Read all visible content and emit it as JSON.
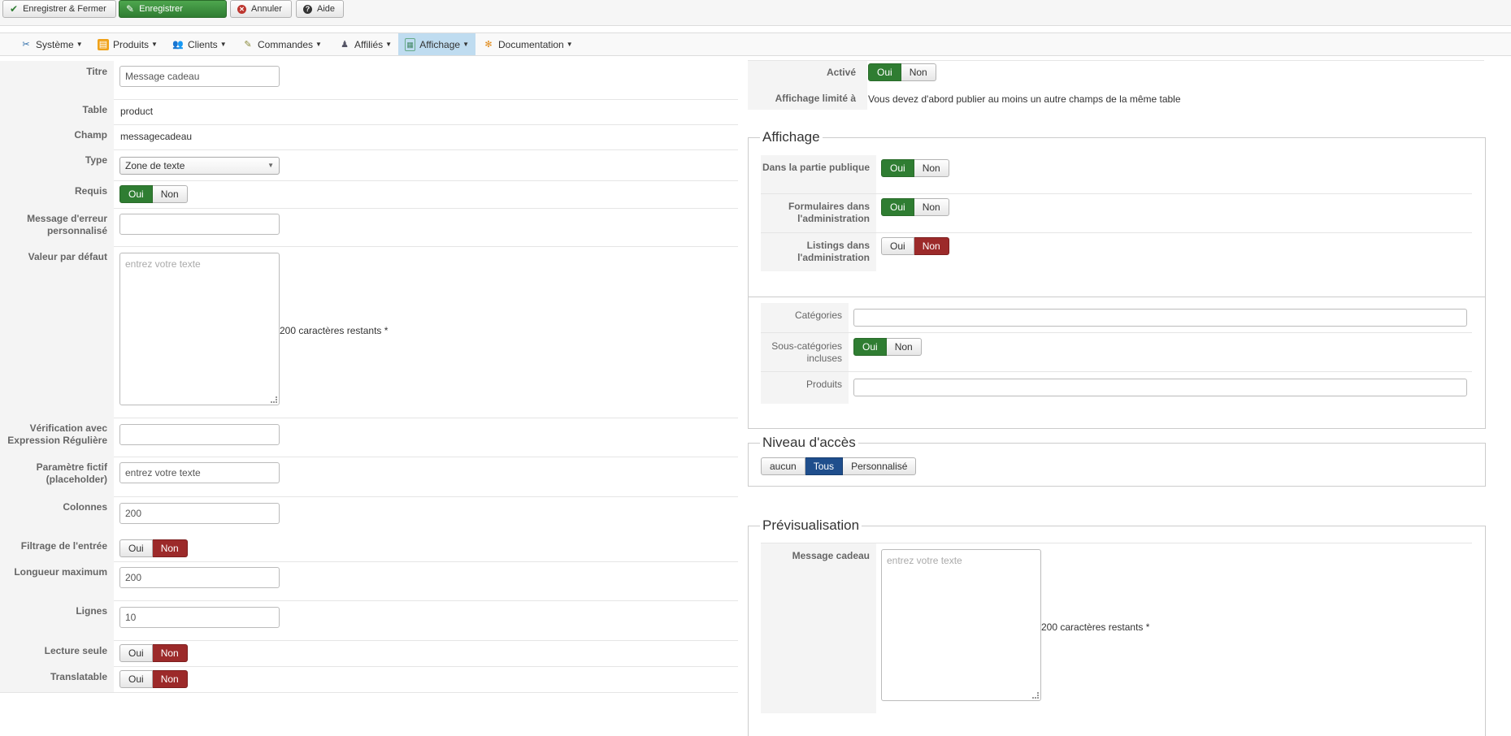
{
  "toolbar": {
    "save_close": "Enregistrer & Fermer",
    "save": "Enregistrer",
    "cancel": "Annuler",
    "help": "Aide"
  },
  "menu": {
    "items": [
      "Système",
      "Produits",
      "Clients",
      "Commandes",
      "Affiliés",
      "Affichage",
      "Documentation"
    ],
    "active": "Affichage"
  },
  "form": {
    "title_label": "Titre",
    "title_value": "Message cadeau",
    "table_label": "Table",
    "table_value": "product",
    "field_label": "Champ",
    "field_value": "messagecadeau",
    "type_label": "Type",
    "type_value": "Zone de texte",
    "required_label": "Requis",
    "error_label": "Message d'erreur personnalisé",
    "default_label": "Valeur par défaut",
    "default_placeholder": "entrez votre texte",
    "chars_remaining": "200 caractères restants *",
    "regex_label": "Vérification avec Expression Régulière",
    "placeholder_label": "Paramètre fictif (placeholder)",
    "placeholder_value": "entrez votre texte",
    "cols_label": "Colonnes",
    "cols_value": "200",
    "filter_label": "Filtrage de l'entrée",
    "maxlen_label": "Longueur maximum",
    "maxlen_value": "200",
    "rows_label": "Lignes",
    "rows_value": "10",
    "readonly_label": "Lecture seule",
    "translatable_label": "Translatable",
    "oui": "Oui",
    "non": "Non"
  },
  "right": {
    "active_label": "Activé",
    "limited_label": "Affichage limité à",
    "limited_text": "Vous devez d'abord publier au moins un autre champs de la même table",
    "display_legend": "Affichage",
    "public_label": "Dans la partie publique",
    "admin_forms_label": "Formulaires dans l'administration",
    "admin_listings_label": "Listings dans l'administration",
    "categories_label": "Catégories",
    "subcats_label": "Sous-catégories incluses",
    "products_label": "Produits",
    "access_legend": "Niveau d'accès",
    "access_none": "aucun",
    "access_all": "Tous",
    "access_custom": "Personnalisé",
    "preview_legend": "Prévisualisation",
    "preview_label": "Message cadeau",
    "preview_placeholder": "entrez votre texte",
    "preview_chars": "200 caractères restants *"
  },
  "colors": {
    "green": "#2f7d32",
    "red": "#9c2a2a",
    "blue": "#1f4e8c",
    "menu_active": "#bfdcf0"
  }
}
